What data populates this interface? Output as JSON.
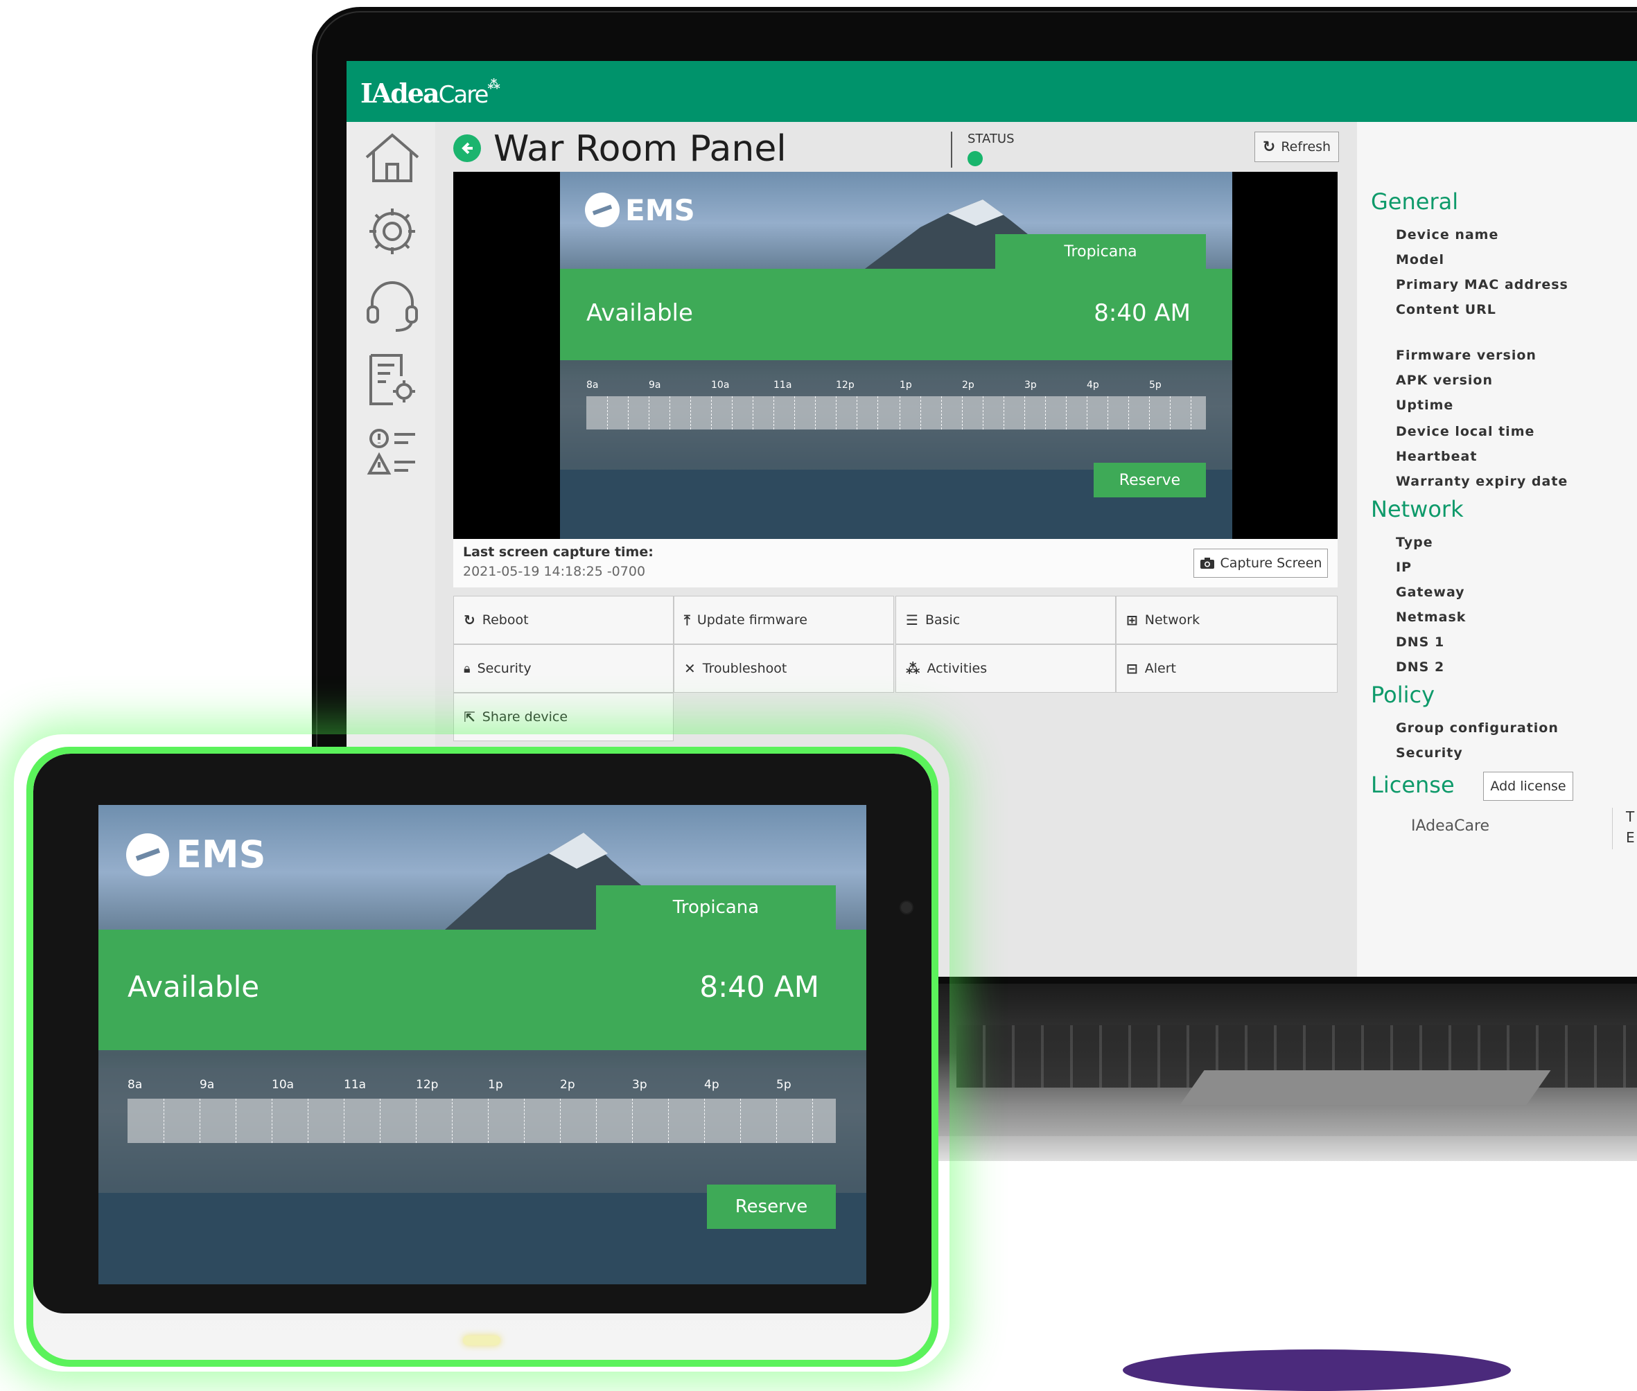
{
  "app": {
    "logo_main": "IAdea",
    "logo_sub": "Care"
  },
  "nav": {
    "items": [
      "home-icon",
      "gear-icon",
      "headset-icon",
      "settings-document-icon",
      "alerts-list-icon"
    ]
  },
  "device": {
    "title": "War Room Panel",
    "status_label": "STATUS",
    "refresh_label": "Refresh",
    "last_capture_label": "Last screen capture time:",
    "last_capture_time": "2021-05-19 14:18:25 -0700",
    "capture_label": "Capture Screen"
  },
  "actions": [
    {
      "label": "Reboot",
      "icon": "refresh-icon"
    },
    {
      "label": "Update firmware",
      "icon": "upload-icon"
    },
    {
      "label": "Basic",
      "icon": "sliders-icon"
    },
    {
      "label": "Network",
      "icon": "network-icon"
    },
    {
      "label": "Security",
      "icon": "lock-icon"
    },
    {
      "label": "Troubleshoot",
      "icon": "tools-icon"
    },
    {
      "label": "Activities",
      "icon": "activities-icon"
    },
    {
      "label": "Alert",
      "icon": "alert-icon"
    },
    {
      "label": "Share device",
      "icon": "share-icon"
    }
  ],
  "details": {
    "general": {
      "title": "General",
      "fields": [
        "Device name",
        "Model",
        "Primary MAC address",
        "Content URL",
        "Firmware version",
        "APK version",
        "Uptime",
        "Device local time",
        "Heartbeat",
        "Warranty expiry date"
      ]
    },
    "network": {
      "title": "Network",
      "fields": [
        "Type",
        "IP",
        "Gateway",
        "Netmask",
        "DNS 1",
        "DNS 2"
      ]
    },
    "policy": {
      "title": "Policy",
      "fields": [
        "Group configuration",
        "Security"
      ]
    },
    "license": {
      "title": "License",
      "add_label": "Add license",
      "name": "IAdeaCare",
      "trunc_1": "T",
      "trunc_2": "E"
    }
  },
  "ems": {
    "logo": "EMS",
    "room": "Tropicana",
    "status": "Available",
    "time": "8:40 AM",
    "timeline": [
      "8a",
      "9a",
      "10a",
      "11a",
      "12p",
      "1p",
      "2p",
      "3p",
      "4p",
      "5p"
    ],
    "reserve": "Reserve"
  },
  "colors": {
    "brand_green": "#00936b",
    "section_green": "#0e9a6a",
    "ems_green": "#3eaa57",
    "status_online": "#18b56c",
    "tablet_bezel_glow": "#5bf25b"
  }
}
